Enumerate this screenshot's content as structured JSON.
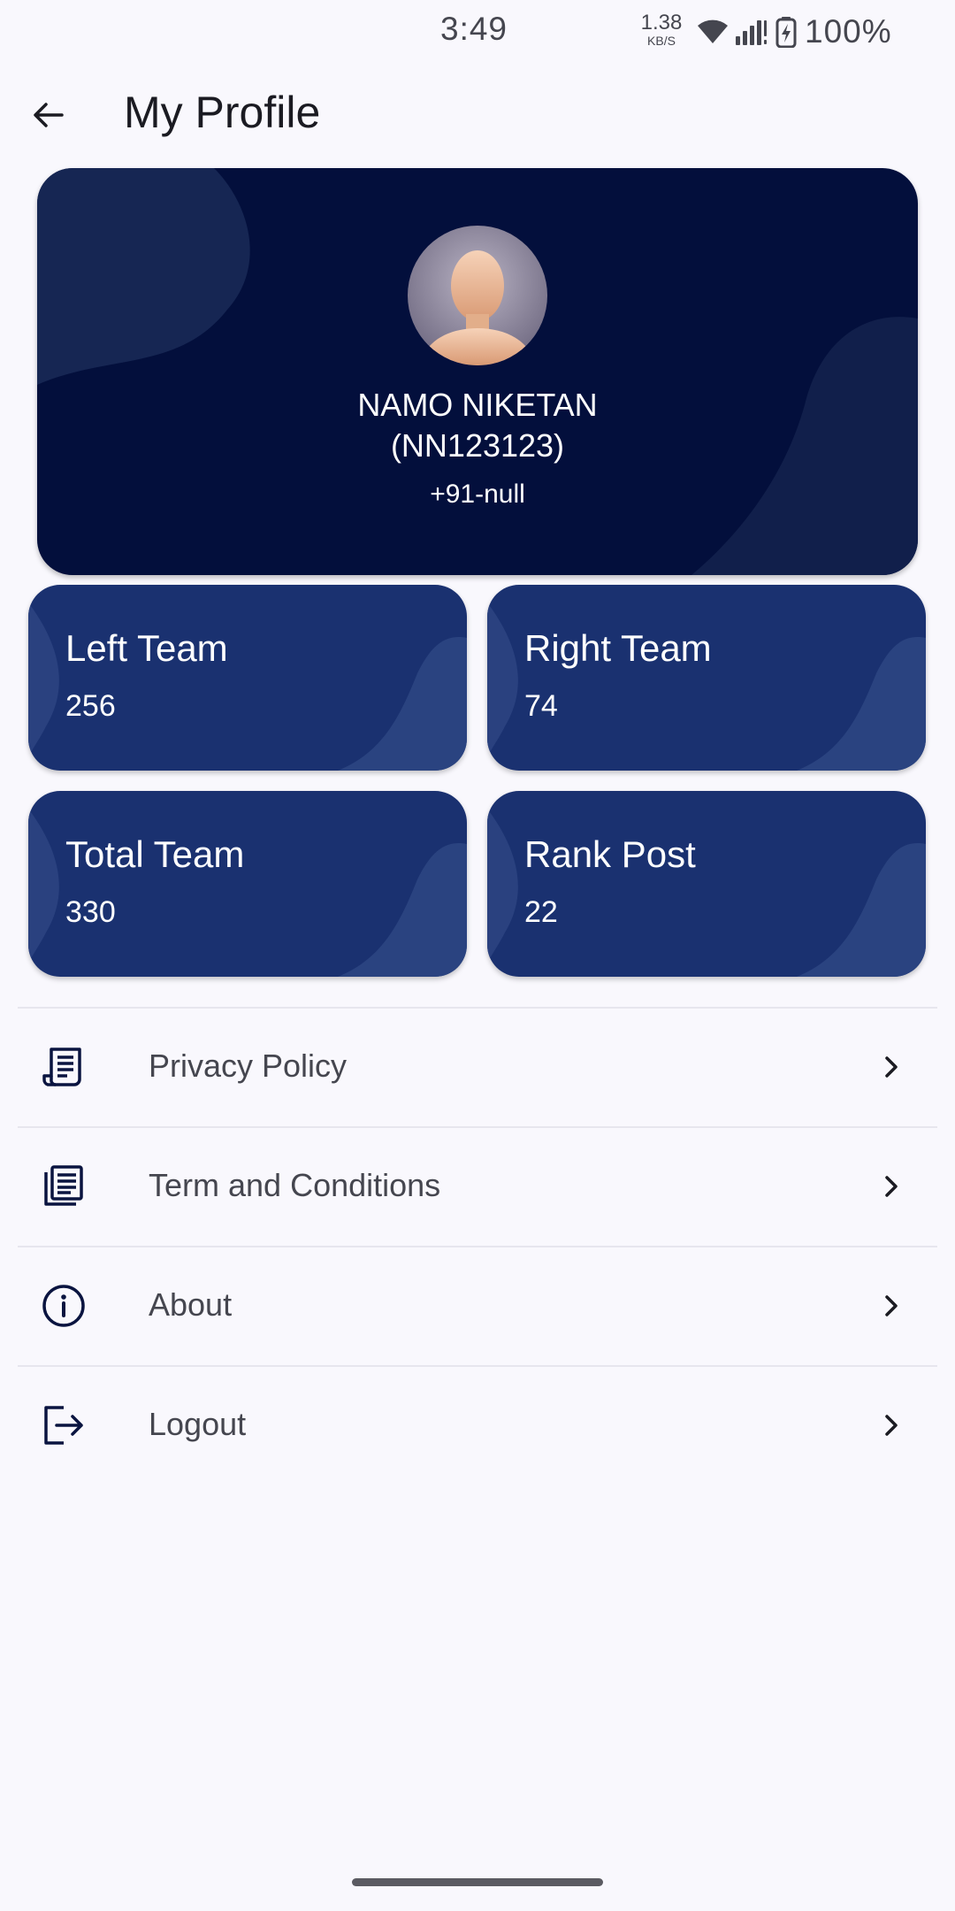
{
  "status_bar": {
    "time": "3:49",
    "net_speed": "1.38",
    "net_unit": "KB/S",
    "battery": "100%",
    "icons": [
      "wifi-icon",
      "signal-icon",
      "battery-charging-icon"
    ]
  },
  "app_bar": {
    "back_icon": "arrow-back-icon",
    "title": "My Profile"
  },
  "profile": {
    "name": "NAMO NIKETAN",
    "id": "(NN123123)",
    "phone": "+91-null",
    "avatar_icon": "avatar-placeholder"
  },
  "stats": [
    {
      "label": "Left Team",
      "value": "256"
    },
    {
      "label": "Right Team",
      "value": "74"
    },
    {
      "label": "Total Team",
      "value": "330"
    },
    {
      "label": "Rank Post",
      "value": "22"
    }
  ],
  "menu": [
    {
      "label": "Privacy Policy",
      "icon": "policy-document-icon"
    },
    {
      "label": "Term and Conditions",
      "icon": "terms-copy-icon"
    },
    {
      "label": "About",
      "icon": "info-icon"
    },
    {
      "label": "Logout",
      "icon": "logout-icon"
    }
  ],
  "colors": {
    "background": "#F9F8FD",
    "profile_card": "#030F3C",
    "stat_card": "#1A3170",
    "text_primary": "#1B1B22",
    "text_secondary": "#45464F"
  }
}
